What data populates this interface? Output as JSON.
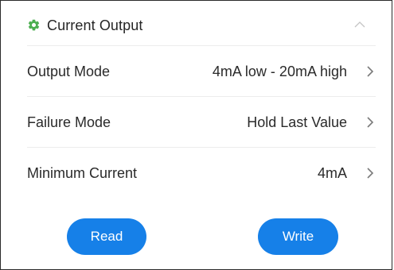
{
  "section": {
    "title": "Current Output",
    "icon": "gear-icon",
    "icon_color": "#4caf50",
    "collapse_icon": "chevron-up-icon"
  },
  "rows": [
    {
      "label": "Output Mode",
      "value": "4mA low - 20mA high"
    },
    {
      "label": "Failure Mode",
      "value": "Hold Last Value"
    },
    {
      "label": "Minimum Current",
      "value": "4mA"
    }
  ],
  "actions": {
    "read_label": "Read",
    "write_label": "Write",
    "button_color": "#1680e8"
  }
}
